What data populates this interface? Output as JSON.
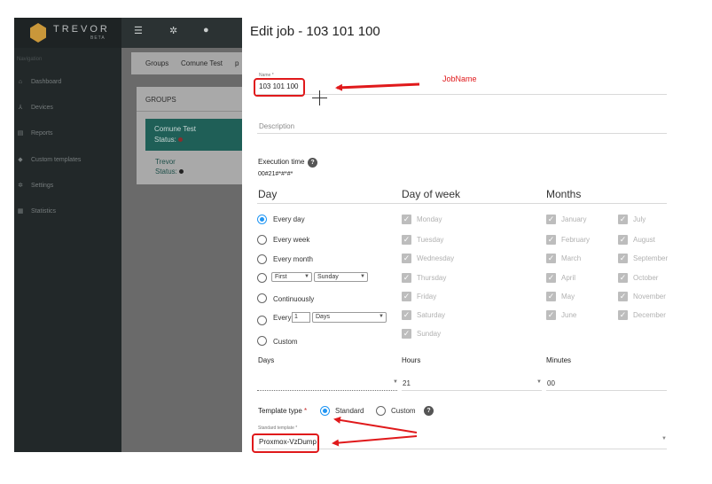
{
  "sidebar": {
    "logo_text": "TREVOR",
    "logo_sub": "BETA",
    "nav_heading": "Navigation",
    "items": [
      {
        "label": "Dashboard",
        "icon": "home-icon"
      },
      {
        "label": "Devices",
        "icon": "sitemap-icon"
      },
      {
        "label": "Reports",
        "icon": "reports-icon"
      },
      {
        "label": "Custom templates",
        "icon": "tag-icon"
      },
      {
        "label": "Settings",
        "icon": "gear-icon"
      },
      {
        "label": "Statistics",
        "icon": "grid-icon"
      }
    ]
  },
  "topbar": {
    "icons": [
      "hamburger-icon",
      "gear-icon",
      "palette-icon"
    ]
  },
  "breadcrumb": [
    "Groups",
    "Comune Test",
    "p"
  ],
  "groups": {
    "heading": "GROUPS",
    "items": [
      {
        "name": "Comune Test",
        "status": "Status:"
      },
      {
        "name": "Trevor",
        "status": "Status:"
      }
    ]
  },
  "dialog": {
    "title": "Edit job - 103 101 100",
    "name_label": "Name *",
    "name_value": "103 101 100",
    "description_placeholder": "Description",
    "execution_time_label": "Execution time",
    "cron": "00#21#*#*#*",
    "columns": {
      "day": "Day",
      "day_of_week": "Day of week",
      "months": "Months"
    },
    "day_options": {
      "every_day": "Every day",
      "every_week": "Every week",
      "every_month": "Every month",
      "first_select": "First",
      "weekday_select": "Sunday",
      "continuously": "Continuously",
      "every": "Every",
      "every_number": "1",
      "unit_select": "Days",
      "custom": "Custom",
      "selected": "every_day"
    },
    "weekdays": [
      "Monday",
      "Tuesday",
      "Wednesday",
      "Thursday",
      "Friday",
      "Saturday",
      "Sunday"
    ],
    "months_col1": [
      "January",
      "February",
      "March",
      "April",
      "May",
      "June"
    ],
    "months_col2": [
      "July",
      "August",
      "September",
      "October",
      "November",
      "December"
    ],
    "days_label": "Days",
    "hours_label": "Hours",
    "hours_value": "21",
    "minutes_label": "Minutes",
    "minutes_value": "00",
    "template_type_label": "Template type",
    "required_mark": "*",
    "template_standard": "Standard",
    "template_custom": "Custom",
    "standard_template_label": "Standard template *",
    "standard_template_value": "Proxmox-VzDump"
  },
  "annotations": {
    "jobname": "JobName",
    "color": "#e0191b"
  },
  "colors": {
    "accent": "#2196f3",
    "sidebar_bg": "#222829",
    "group_selected": "#1f5f57"
  }
}
